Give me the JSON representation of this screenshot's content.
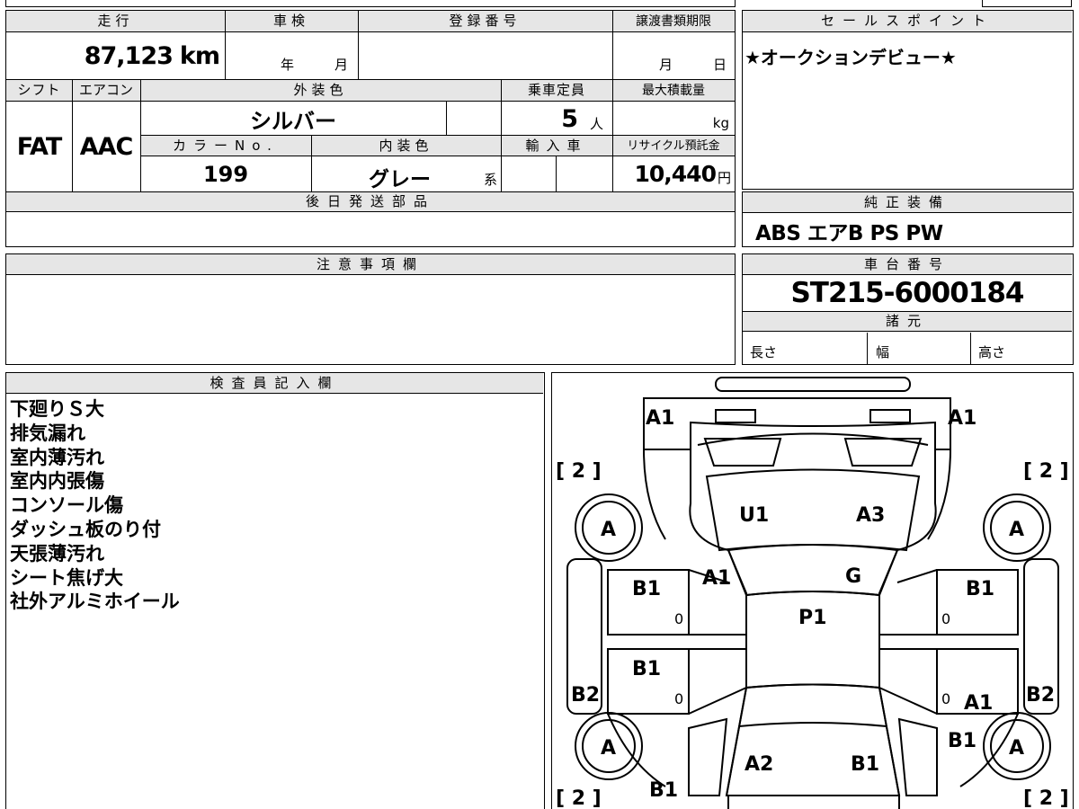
{
  "vehicle": {
    "header_labels": {
      "mileage": "走行",
      "inspection": "車検",
      "registration_number": "登録番号",
      "transfer_deadline": "譲渡書類期限",
      "shift": "シフト",
      "aircon": "エアコン",
      "exterior_color": "外装色",
      "capacity": "乗車定員",
      "max_load": "最大積載量",
      "color_no": "カラーNo.",
      "interior_color": "内装色",
      "import": "輸入車",
      "recycle_fee": "リサイクル預託金",
      "later_parts": "後日発送部品"
    },
    "mileage_value": "87,123",
    "mileage_unit": "km",
    "inspection_year_unit": "年",
    "inspection_month_unit": "月",
    "deadline_month_unit": "月",
    "deadline_day_unit": "日",
    "shift_value": "FAT",
    "aircon_value": "AAC",
    "exterior_color_value": "シルバー",
    "capacity_value": "5",
    "capacity_unit": "人",
    "max_load_unit": "kg",
    "color_no_value": "199",
    "interior_color_value": "グレー",
    "interior_color_suffix": "系",
    "recycle_fee_value": "10,440",
    "recycle_fee_unit": "円"
  },
  "sales_point": {
    "header": "セールスポイント",
    "text": "★オークションデビュー★"
  },
  "genuine_equipment": {
    "header": "純正装備",
    "text": "ABS エアB PS PW"
  },
  "caution": {
    "header": "注意事項欄"
  },
  "chassis": {
    "header": "車台番号",
    "value": "ST215-6000184",
    "specs_header": "諸元",
    "length_label": "長さ",
    "width_label": "幅",
    "height_label": "高さ"
  },
  "inspector": {
    "header": "検査員記入欄",
    "notes": [
      "下廻りＳ大",
      "排気漏れ",
      "室内薄汚れ",
      "室内内張傷",
      "コンソール傷",
      "ダッシュ板のり付",
      "天張薄汚れ",
      "シート焦げ大",
      "社外アルミホイール"
    ]
  },
  "diagram": {
    "marks": {
      "front_left_bumper": "A1",
      "front_right_bumper": "A1",
      "bracket_front_left": "[ 2 ]",
      "bracket_front_right": "[ 2 ]",
      "bracket_rear_left": "[ 2 ]",
      "bracket_rear_right": "[ 2 ]",
      "tire_front_left": "A",
      "tire_front_right": "A",
      "tire_rear_left": "A",
      "tire_rear_right": "A",
      "hood_left": "U1",
      "hood_right": "A3",
      "windshield_left": "A1",
      "windshield_right": "G",
      "roof": "P1",
      "front_door_left": "B1",
      "front_door_right": "B1",
      "rear_door_left": "B1",
      "rear_door_right": "A1",
      "rear_right_quarter": "B1",
      "rocker_left": "B2",
      "rocker_right": "B2",
      "rear_hatch_left": "A2",
      "rear_hatch_right": "B1",
      "rear_bumper_left": "B1",
      "door_zero_1": "0",
      "door_zero_2": "0",
      "door_zero_3": "0",
      "door_zero_4": "0"
    }
  }
}
